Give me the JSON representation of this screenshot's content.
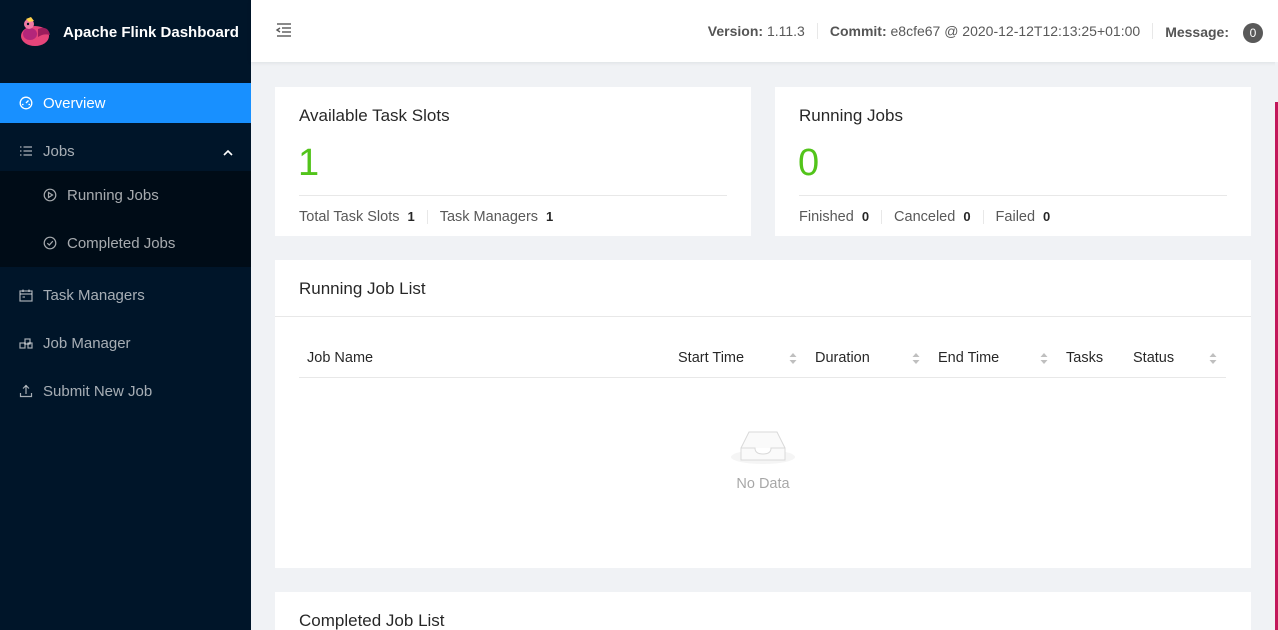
{
  "app": {
    "title": "Apache Flink Dashboard"
  },
  "sidebar": {
    "items": [
      {
        "label": "Overview",
        "icon": "dashboard-icon",
        "active": true
      },
      {
        "label": "Jobs",
        "icon": "list-icon",
        "expanded": true,
        "children": [
          {
            "label": "Running Jobs",
            "icon": "play-circle-icon"
          },
          {
            "label": "Completed Jobs",
            "icon": "check-circle-icon"
          }
        ]
      },
      {
        "label": "Task Managers",
        "icon": "schedule-icon"
      },
      {
        "label": "Job Manager",
        "icon": "cluster-icon"
      },
      {
        "label": "Submit New Job",
        "icon": "upload-icon"
      }
    ]
  },
  "header": {
    "version_label": "Version:",
    "version_value": "1.11.3",
    "commit_label": "Commit:",
    "commit_value": "e8cfe67 @ 2020-12-12T12:13:25+01:00",
    "message_label": "Message:",
    "message_count": "0"
  },
  "slots_card": {
    "title": "Available Task Slots",
    "value": "1",
    "total_label": "Total Task Slots",
    "total_value": "1",
    "tm_label": "Task Managers",
    "tm_value": "1"
  },
  "jobs_card": {
    "title": "Running Jobs",
    "value": "0",
    "finished_label": "Finished",
    "finished_value": "0",
    "canceled_label": "Canceled",
    "canceled_value": "0",
    "failed_label": "Failed",
    "failed_value": "0"
  },
  "running_list": {
    "title": "Running Job List",
    "columns": [
      "Job Name",
      "Start Time",
      "Duration",
      "End Time",
      "Tasks",
      "Status"
    ],
    "empty_text": "No Data"
  },
  "completed_list": {
    "title": "Completed Job List"
  },
  "colors": {
    "sidebar_bg": "#001529",
    "active": "#1890ff",
    "number": "#52c41a"
  }
}
